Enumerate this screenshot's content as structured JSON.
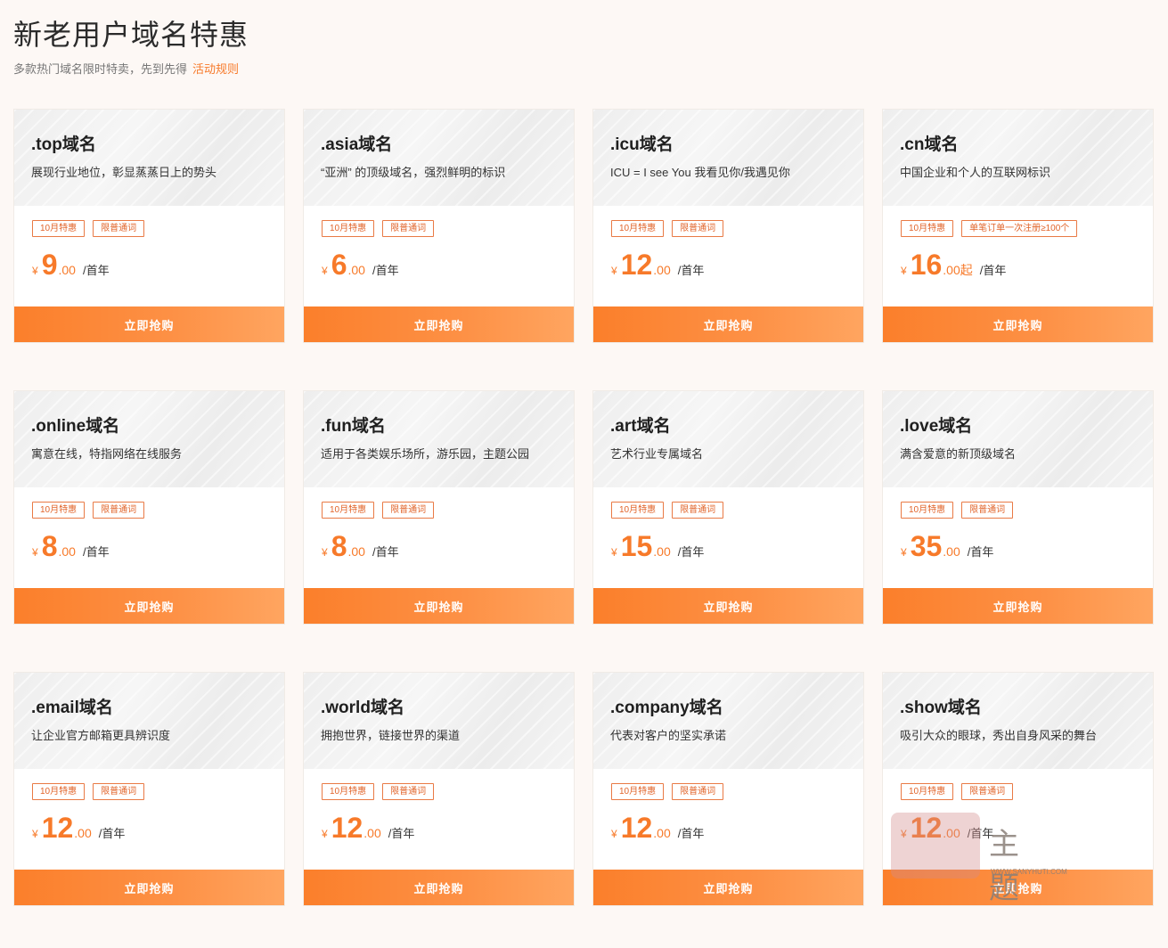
{
  "header": {
    "title": "新老用户域名特惠",
    "subtitle": "多款热门域名限时特卖，先到先得",
    "rules_link": "活动规则"
  },
  "colors": {
    "accent": "#f77a2a",
    "button_start": "#fb7f2b",
    "button_end": "#ffa560",
    "page_bg": "#fdf8f5"
  },
  "buy_label": "立即抢购",
  "cards": [
    {
      "name": ".top域名",
      "desc": "展现行业地位，彰显蒸蒸日上的势头",
      "tags": [
        "10月特惠",
        "限普通词"
      ],
      "currency": "¥",
      "price": "9",
      "decimal": ".00",
      "unit": "/首年"
    },
    {
      "name": ".asia域名",
      "desc": "“亚洲” 的顶级域名，强烈鲜明的标识",
      "tags": [
        "10月特惠",
        "限普通词"
      ],
      "currency": "¥",
      "price": "6",
      "decimal": ".00",
      "unit": "/首年"
    },
    {
      "name": ".icu域名",
      "desc": "ICU = I see You 我看见你/我遇见你",
      "tags": [
        "10月特惠",
        "限普通词"
      ],
      "currency": "¥",
      "price": "12",
      "decimal": ".00",
      "unit": "/首年"
    },
    {
      "name": ".cn域名",
      "desc": "中国企业和个人的互联网标识",
      "tags": [
        "10月特惠",
        "单笔订单一次注册≥100个"
      ],
      "currency": "¥",
      "price": "16",
      "decimal": ".00起",
      "unit": "/首年"
    },
    {
      "name": ".online域名",
      "desc": "寓意在线，特指网络在线服务",
      "tags": [
        "10月特惠",
        "限普通词"
      ],
      "currency": "¥",
      "price": "8",
      "decimal": ".00",
      "unit": "/首年"
    },
    {
      "name": ".fun域名",
      "desc": "适用于各类娱乐场所，游乐园，主题公园",
      "tags": [
        "10月特惠",
        "限普通词"
      ],
      "currency": "¥",
      "price": "8",
      "decimal": ".00",
      "unit": "/首年"
    },
    {
      "name": ".art域名",
      "desc": "艺术行业专属域名",
      "tags": [
        "10月特惠",
        "限普通词"
      ],
      "currency": "¥",
      "price": "15",
      "decimal": ".00",
      "unit": "/首年"
    },
    {
      "name": ".love域名",
      "desc": "满含爱意的新顶级域名",
      "tags": [
        "10月特惠",
        "限普通词"
      ],
      "currency": "¥",
      "price": "35",
      "decimal": ".00",
      "unit": "/首年"
    },
    {
      "name": ".email域名",
      "desc": "让企业官方邮箱更具辨识度",
      "tags": [
        "10月特惠",
        "限普通词"
      ],
      "currency": "¥",
      "price": "12",
      "decimal": ".00",
      "unit": "/首年"
    },
    {
      "name": ".world域名",
      "desc": "拥抱世界，链接世界的渠道",
      "tags": [
        "10月特惠",
        "限普通词"
      ],
      "currency": "¥",
      "price": "12",
      "decimal": ".00",
      "unit": "/首年"
    },
    {
      "name": ".company域名",
      "desc": "代表对客户的坚实承诺",
      "tags": [
        "10月特惠",
        "限普通词"
      ],
      "currency": "¥",
      "price": "12",
      "decimal": ".00",
      "unit": "/首年"
    },
    {
      "name": ".show域名",
      "desc": "吸引大众的眼球，秀出自身风采的舞台",
      "tags": [
        "10月特惠",
        "限普通词"
      ],
      "currency": "¥",
      "price": "12",
      "decimal": ".00",
      "unit": "/首年"
    }
  ],
  "watermark": {
    "text": "主 题",
    "url": "WWW.SANYHUTI.COM"
  }
}
